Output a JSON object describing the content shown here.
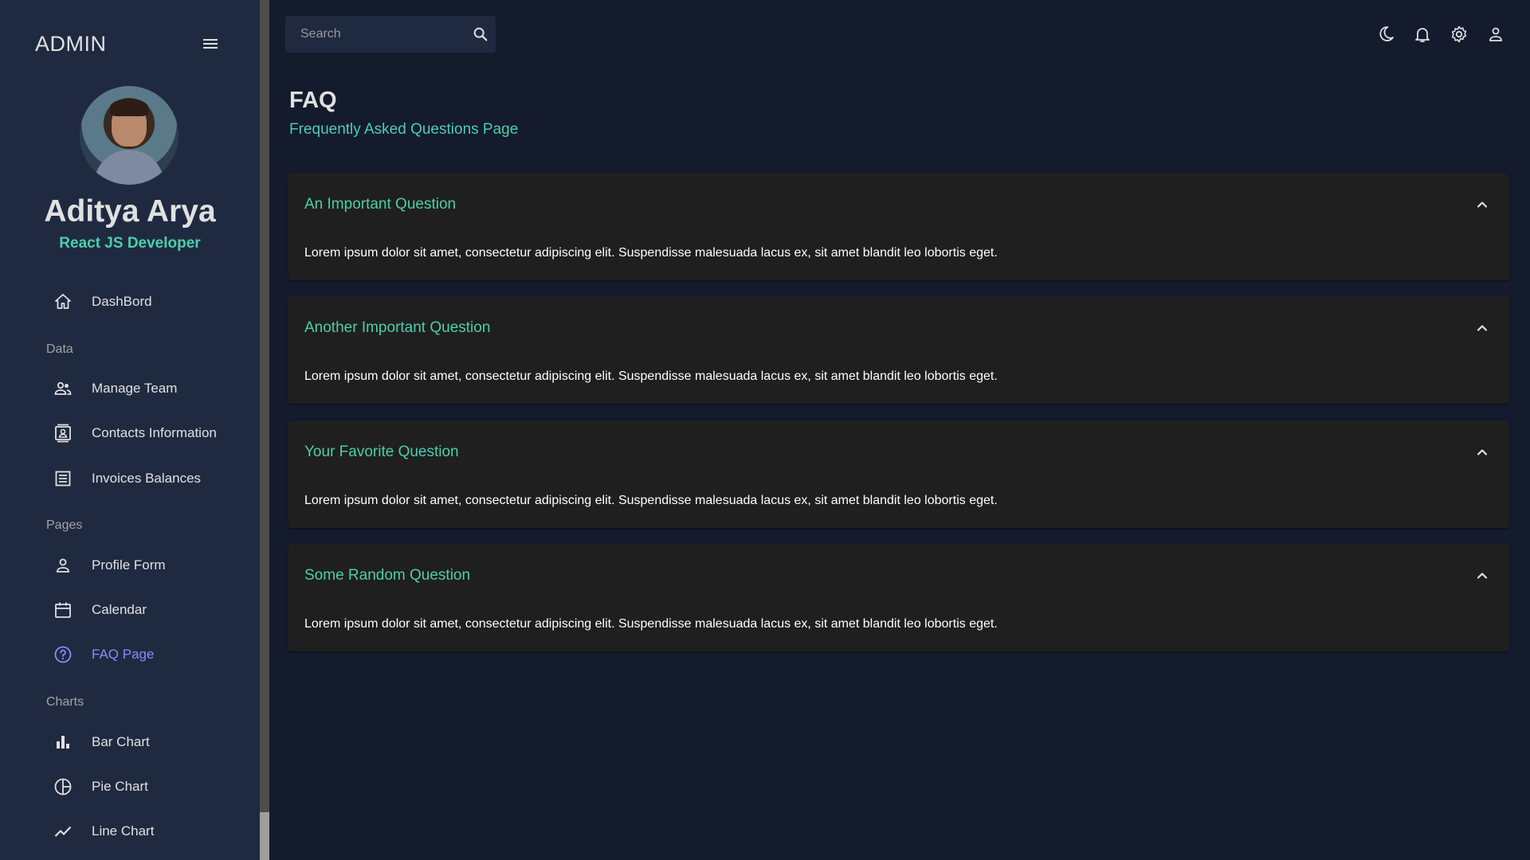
{
  "sidebar": {
    "brand": "ADMIN",
    "user": {
      "name": "Aditya Arya",
      "role": "React JS Developer"
    },
    "items": [
      {
        "label": "DashBord",
        "icon": "home-icon"
      },
      {
        "label": "Manage Team",
        "icon": "people-icon"
      },
      {
        "label": "Contacts Information",
        "icon": "contacts-icon"
      },
      {
        "label": "Invoices Balances",
        "icon": "receipt-icon"
      },
      {
        "label": "Profile Form",
        "icon": "person-icon"
      },
      {
        "label": "Calendar",
        "icon": "calendar-icon"
      },
      {
        "label": "FAQ Page",
        "icon": "help-icon",
        "active": true
      },
      {
        "label": "Bar Chart",
        "icon": "bar-chart-icon"
      },
      {
        "label": "Pie Chart",
        "icon": "pie-chart-icon"
      },
      {
        "label": "Line Chart",
        "icon": "line-chart-icon"
      }
    ],
    "sections": [
      "Data",
      "Pages",
      "Charts"
    ]
  },
  "topbar": {
    "search_placeholder": "Search",
    "icons": [
      "dark-mode-icon",
      "notifications-icon",
      "settings-icon",
      "account-icon"
    ]
  },
  "header": {
    "title": "FAQ",
    "subtitle": "Frequently Asked Questions Page"
  },
  "faqs": [
    {
      "question": "An Important Question",
      "answer": "Lorem ipsum dolor sit amet, consectetur adipiscing elit. Suspendisse malesuada lacus ex, sit amet blandit leo lobortis eget."
    },
    {
      "question": "Another Important Question",
      "answer": "Lorem ipsum dolor sit amet, consectetur adipiscing elit. Suspendisse malesuada lacus ex, sit amet blandit leo lobortis eget."
    },
    {
      "question": "Your Favorite Question",
      "answer": "Lorem ipsum dolor sit amet, consectetur adipiscing elit. Suspendisse malesuada lacus ex, sit amet blandit leo lobortis eget."
    },
    {
      "question": "Some Random Question",
      "answer": "Lorem ipsum dolor sit amet, consectetur adipiscing elit. Suspendisse malesuada lacus ex, sit amet blandit leo lobortis eget."
    }
  ],
  "colors": {
    "background": "#141b2d",
    "sidebar": "#1f2a40",
    "accent_green": "#4cceac",
    "active_blue": "#868dfb",
    "card": "#1f1f1f"
  }
}
